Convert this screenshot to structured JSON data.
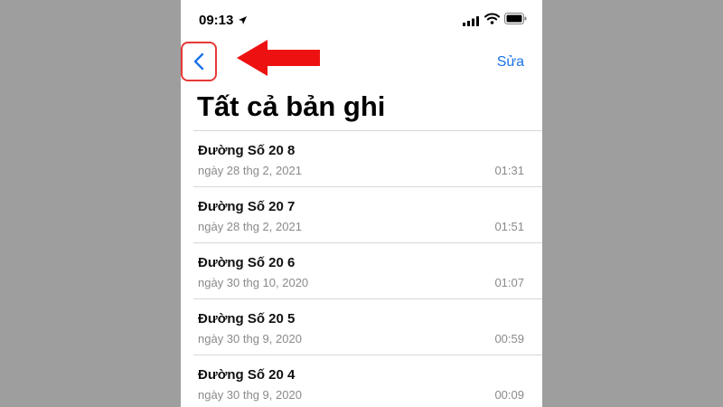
{
  "status_bar": {
    "time": "09:13",
    "icons": [
      "location-arrow-icon",
      "cellular-signal-icon",
      "wifi-icon",
      "battery-icon"
    ]
  },
  "nav": {
    "back_icon": "chevron-left-icon",
    "edit_label": "Sửa",
    "highlight_color": "#e53935",
    "accent_color": "#1a73e8"
  },
  "title": "Tất cả bản ghi",
  "recordings": [
    {
      "title": "Đường Số 20 8",
      "date": "ngày 28 thg 2, 2021",
      "duration": "01:31"
    },
    {
      "title": "Đường Số 20 7",
      "date": "ngày 28 thg 2, 2021",
      "duration": "01:51"
    },
    {
      "title": "Đường Số 20 6",
      "date": "ngày 30 thg 10, 2020",
      "duration": "01:07"
    },
    {
      "title": "Đường Số 20 5",
      "date": "ngày 30 thg 9, 2020",
      "duration": "00:59"
    },
    {
      "title": "Đường Số 20 4",
      "date": "ngày 30 thg 9, 2020",
      "duration": "00:09"
    }
  ]
}
